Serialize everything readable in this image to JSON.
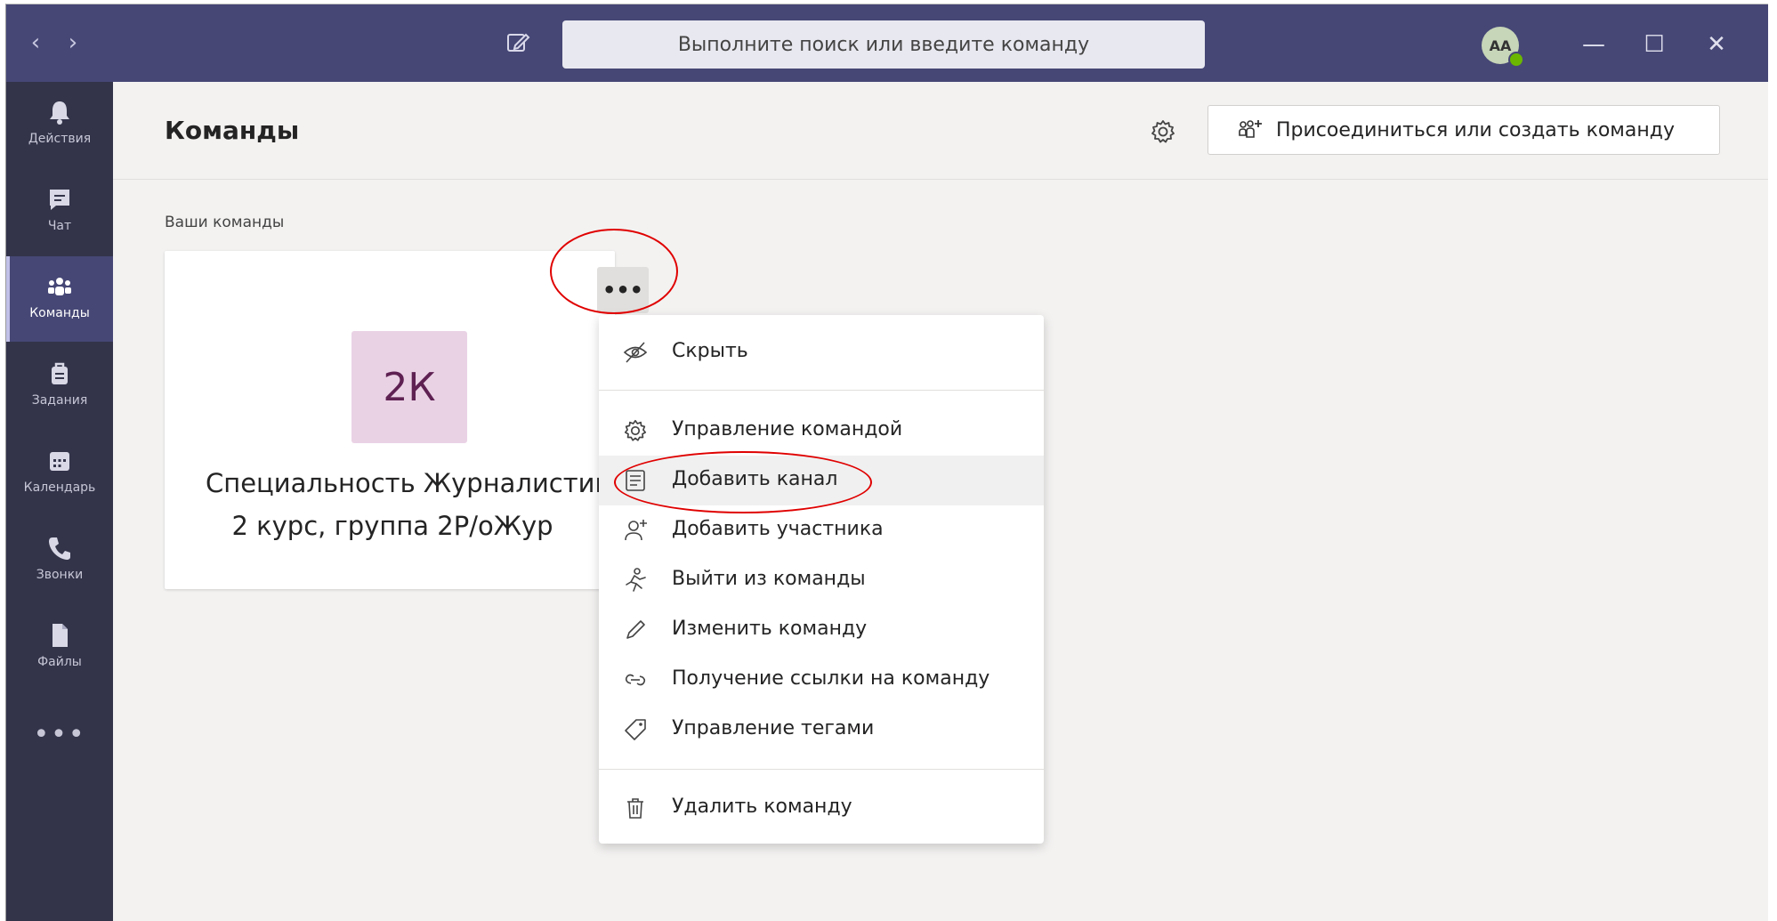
{
  "titlebar": {
    "search_placeholder": "Выполните поиск или введите команду",
    "avatar_initials": "АА",
    "back_glyph": "‹",
    "forward_glyph": "›",
    "minimize_glyph": "—",
    "maximize_glyph": "☐",
    "close_glyph": "✕"
  },
  "rail": {
    "items": [
      {
        "label": "Действия",
        "icon": "bell-icon"
      },
      {
        "label": "Чат",
        "icon": "chat-icon"
      },
      {
        "label": "Команды",
        "icon": "teams-icon",
        "active": true
      },
      {
        "label": "Задания",
        "icon": "assignments-icon"
      },
      {
        "label": "Календарь",
        "icon": "calendar-icon"
      },
      {
        "label": "Звонки",
        "icon": "phone-icon"
      },
      {
        "label": "Файлы",
        "icon": "files-icon"
      }
    ],
    "more_label": "•••"
  },
  "header": {
    "title": "Команды",
    "join_button_label": "Присоединиться или создать команду"
  },
  "section": {
    "your_teams_label": "Ваши команды"
  },
  "team_card": {
    "tile_initials": "2К",
    "name_line1": "Специальность Журналистика",
    "name_line2": "2 курс, группа 2Р/оЖур",
    "more_glyph": "•••",
    "tile_bg": "#ead2e5",
    "tile_fg": "#5e2152"
  },
  "menu": {
    "items": [
      {
        "label": "Скрыть",
        "icon": "hide-icon"
      },
      {
        "label": "Управление командой",
        "icon": "gear-icon"
      },
      {
        "label": "Добавить канал",
        "icon": "add-channel-icon"
      },
      {
        "label": "Добавить участника",
        "icon": "add-member-icon"
      },
      {
        "label": "Выйти из команды",
        "icon": "leave-icon"
      },
      {
        "label": "Изменить команду",
        "icon": "edit-icon"
      },
      {
        "label": "Получение ссылки на команду",
        "icon": "link-icon"
      },
      {
        "label": "Управление тегами",
        "icon": "tag-icon"
      },
      {
        "label": "Удалить команду",
        "icon": "trash-icon"
      }
    ]
  },
  "colors": {
    "titlebar": "#464775",
    "rail": "#33344a",
    "annotation": "#e00000",
    "presence": "#6bb700"
  }
}
